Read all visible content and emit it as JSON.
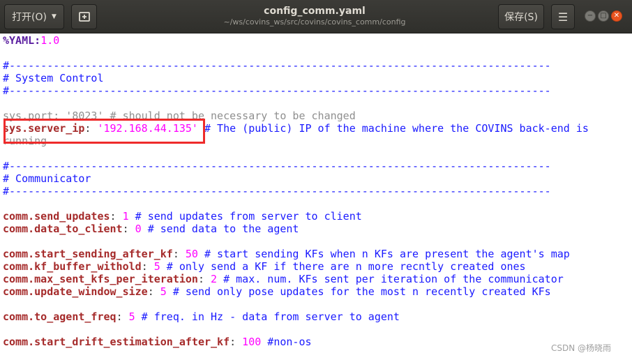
{
  "window": {
    "title": "config_comm.yaml",
    "path": "~/ws/covins_ws/src/covins/covins_comm/config",
    "open_button": "打开(O)",
    "save_button": "保存(S)",
    "menu_icon": "hamburger-icon",
    "close_color": "#e95420"
  },
  "editor": {
    "line1_key": "%YAML",
    "line1_sep": ":",
    "line1_value": "1.0",
    "rule": "#--------------------------------------------------------------------------------------",
    "section1": "# System Control",
    "port_overlay": "sys.port: '8023' # should not be necessary to be changed",
    "ip_key": "sys.server_ip",
    "ip_sep": ": ",
    "ip_value": "'192.168.44.135'",
    "ip_comment": " # The (public) IP of the machine where the COVINS back-end is",
    "wrap_overlay": "running",
    "section2": "# Communicator",
    "send_updates_key": "comm.send_updates",
    "send_updates_value": "1",
    "send_updates_comment": " # send updates from server to client",
    "data_to_client_key": "comm.data_to_client",
    "data_to_client_value": "0",
    "data_to_client_comment": " # send data to the agent",
    "start_sending_key": "comm.start_sending_after_kf",
    "start_sending_value": "50",
    "start_sending_comment": " # start sending KFs when n KFs are present the agent's map",
    "kf_buffer_key": "comm.kf_buffer_withold",
    "kf_buffer_value": "5",
    "kf_buffer_comment": " # only send a KF if there are n more recntly created ones",
    "max_sent_key": "comm.max_sent_kfs_per_iteration",
    "max_sent_value": "2",
    "max_sent_comment": " # max. num. KFs sent per iteration of the communicator",
    "update_window_key": "comm.update_window_size",
    "update_window_value": "5",
    "update_window_comment": " # send only pose updates for the most n recently created KFs",
    "to_agent_freq_key": "comm.to_agent_freq",
    "to_agent_freq_value": "5",
    "to_agent_freq_comment": " # freq. in Hz - data from server to agent",
    "drift_key": "comm.start_drift_estimation_after_kf",
    "drift_value": "100",
    "drift_comment": " #non-os"
  },
  "watermark": "CSDN @杨晓雨"
}
